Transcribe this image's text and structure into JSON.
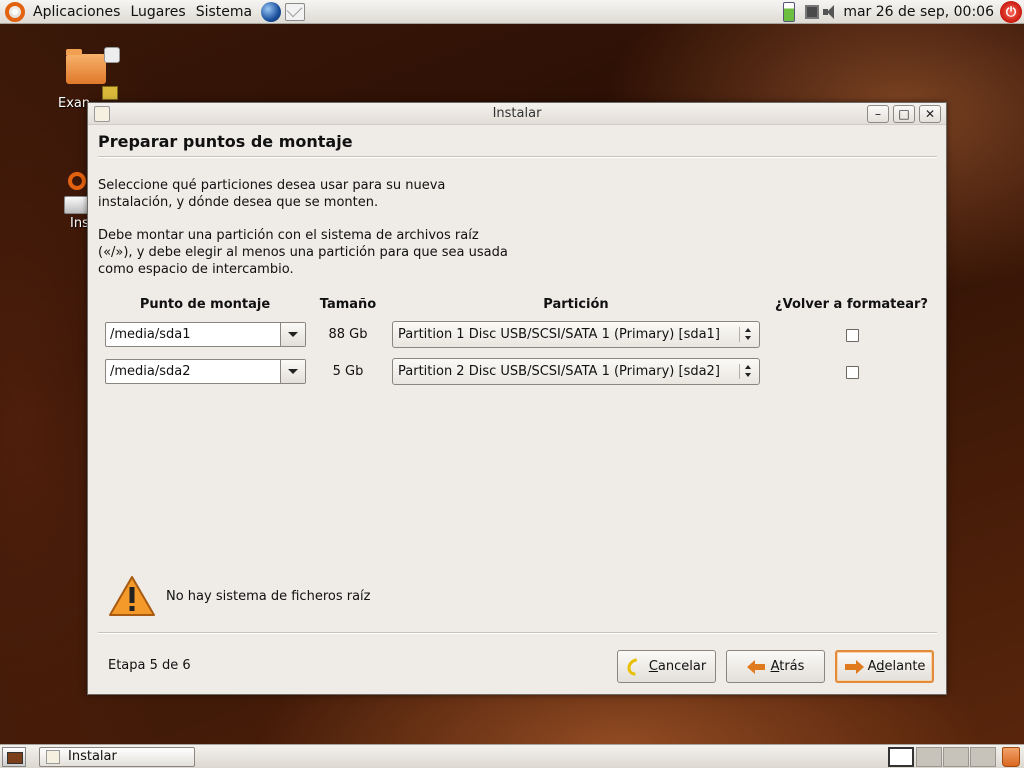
{
  "top_panel": {
    "menu": [
      "Aplicaciones",
      "Lugares",
      "Sistema"
    ],
    "clock": "mar 26 de sep, 00:06"
  },
  "desktop": {
    "icon1_label": "Exan",
    "icon2_label": "Ins"
  },
  "window": {
    "title": "Instalar",
    "heading": "Preparar puntos de montaje",
    "intro": "Seleccione qué particiones desea usar para su nueva\ninstalación, y dónde desea que se monten.",
    "note": "Debe montar una partición con el sistema de archivos raíz\n(«/»), y debe elegir al menos una partición para que sea usada\ncomo espacio de intercambio.",
    "columns": {
      "mount": "Punto de montaje",
      "size": "Tamaño",
      "partition": "Partición",
      "reformat": "¿Volver a formatear?"
    },
    "rows": [
      {
        "mount": "/media/sda1",
        "size": "88 Gb",
        "partition": "Partition 1 Disc USB/SCSI/SATA 1 (Primary) [sda1]",
        "reformat": false
      },
      {
        "mount": "/media/sda2",
        "size": "5 Gb",
        "partition": "Partition 2 Disc USB/SCSI/SATA 1 (Primary) [sda2]",
        "reformat": false
      }
    ],
    "warning": "No hay sistema de ficheros raíz",
    "step": "Etapa 5 de 6",
    "buttons": {
      "cancel": "ancelar",
      "cancel_mnemonic": "C",
      "back": "trás",
      "back_mnemonic": "A",
      "forward_pre": "A",
      "forward_mnemonic": "d",
      "forward_post": "elante"
    }
  },
  "taskbar": {
    "task_label": "Instalar"
  },
  "colors": {
    "accent": "#e07a1e",
    "window_bg": "#efebe7",
    "ubuntu_orange": "#e3620f"
  }
}
